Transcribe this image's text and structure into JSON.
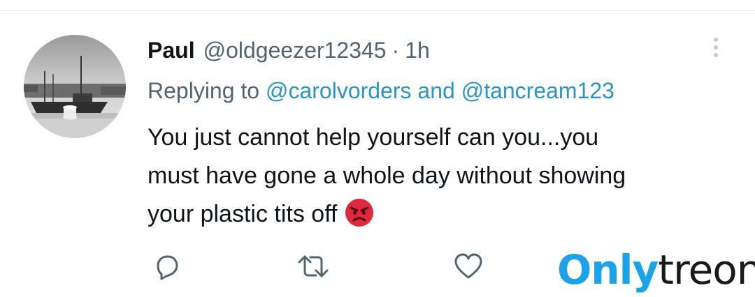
{
  "tweet": {
    "author_name": "Paul",
    "author_handle": "@oldgeezer12345",
    "separator": "·",
    "time": "1h",
    "replying_prefix": "Replying to",
    "reply_mention_1": "@carolvorders",
    "reply_conjunction": "and",
    "reply_mention_2": "@tancream123",
    "text_lines": [
      "You just cannot help yourself can you...you",
      "must have gone a whole day without showing",
      "your plastic tits off"
    ],
    "emoji": "angry-face-emoji"
  },
  "actions": {
    "icons": [
      "reply-icon",
      "retweet-icon",
      "like-icon"
    ]
  },
  "watermark": {
    "part_1": "Only",
    "part_2": "treon",
    "color_1": "#1aa3e8",
    "color_2": "#1a1a1a"
  },
  "colors": {
    "mention": "#2b95c9",
    "secondary_text": "#536471",
    "primary_text": "#0f1419"
  }
}
